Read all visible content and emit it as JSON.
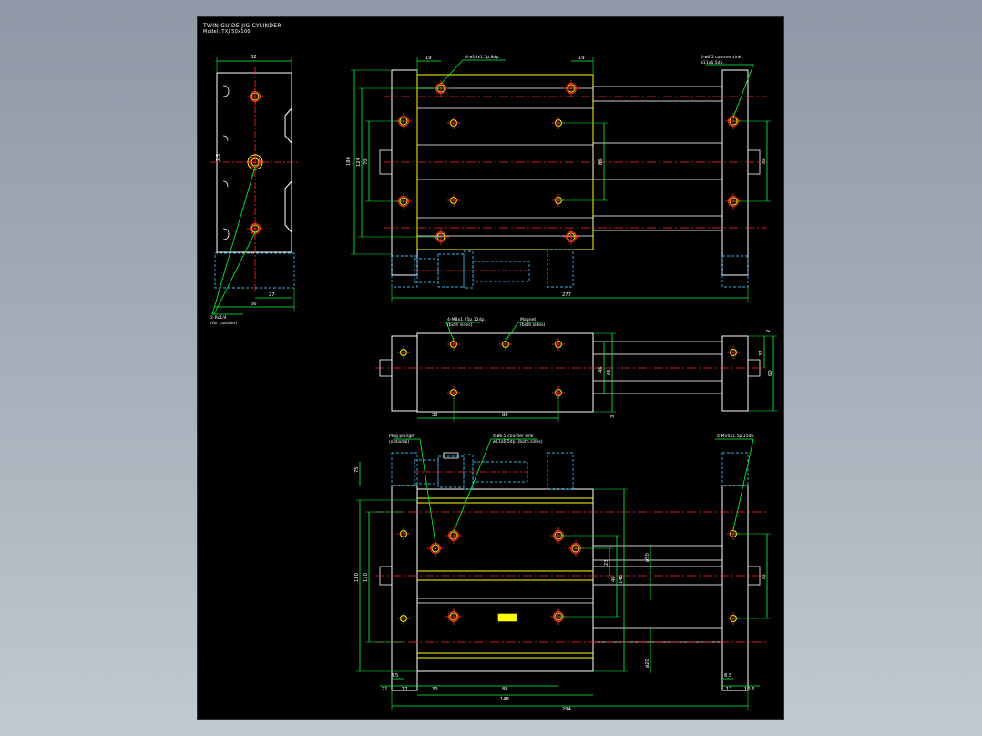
{
  "title_block": {
    "title": "TWIN GUIDE JIG CYLINDER",
    "model": "Model: TXJ  50x100"
  },
  "callouts": {
    "left_1": "2-Rc1/4",
    "left_2": "(for cushion)",
    "top_holes": "4-ø10x1.5p,8dp.",
    "top_right_1": "4-ø6.5 counter sink",
    "top_right_2": "ø11x6.5dp.",
    "mid_holes_1": "4-M8x1.25p,12dp.",
    "mid_holes_2": "(both sides)",
    "magnet_1": "Magnet",
    "magnet_2": "(both sides)",
    "bot_plug_1": "Plug plunger",
    "bot_plug_2": "(optional)",
    "bot_sink_1": "4-ø6.5 counter sink",
    "bot_sink_2": "ø11x6.5dp. (both sides)",
    "bot_tap": "4-M10x1.5p,15dp."
  },
  "dims": {
    "d62": "62",
    "d2_5": "2.5",
    "d27": "27",
    "d66": "66",
    "d19a": "19",
    "d19b": "19",
    "d186": "186",
    "d124": "124",
    "d70a": "70",
    "d86": "86",
    "d70b": "70",
    "d277": "277",
    "d2a": "2",
    "d37": "37",
    "d46": "46",
    "d66b": "66",
    "d60": "60",
    "d3": "3",
    "d30a": "30",
    "d88a": "88",
    "d75": "75",
    "d130": "130",
    "d110": "110",
    "d23": "23",
    "d46b": "46",
    "d148v": "148",
    "d450": "ø50",
    "d620": "ø20",
    "d70c": "70",
    "d8_5a": "8.5",
    "d17a": "17",
    "d30b": "30",
    "d88b": "88",
    "d8_5b": "8.5",
    "d21": "21",
    "d148": "148",
    "d17b": "17",
    "d10_5": "10.5",
    "d294": "294"
  }
}
